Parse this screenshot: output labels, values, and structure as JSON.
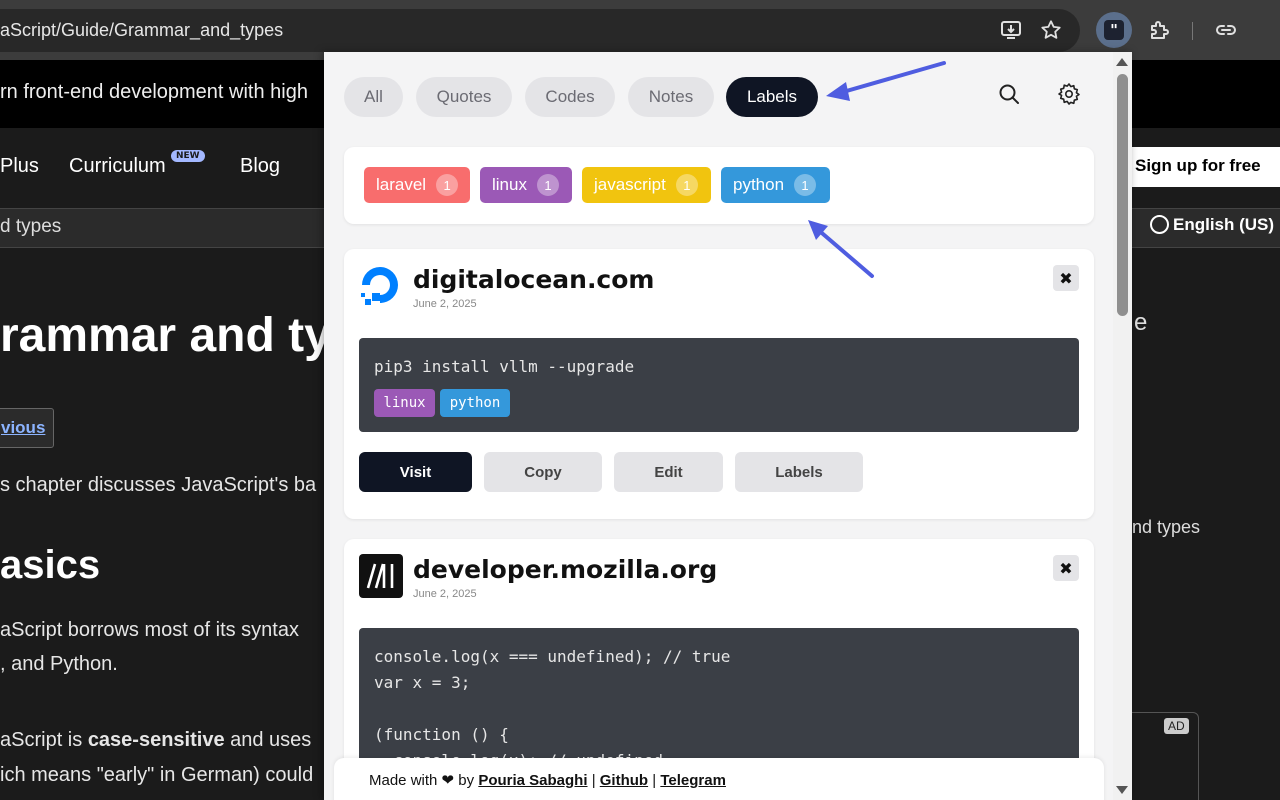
{
  "browser": {
    "url": "aScript/Guide/Grammar_and_types"
  },
  "background_page": {
    "banner": "rn front-end development with high",
    "nav": [
      {
        "label": "Plus"
      },
      {
        "label": "Curriculum"
      },
      {
        "label": "Blog"
      }
    ],
    "new_badge": "NEW",
    "signup": "Sign up for free",
    "breadcrumb": "d types",
    "language": "English (US)",
    "title": "rammar and ty",
    "previous": "vious",
    "intro": "s chapter discusses JavaScript's ba",
    "heading2": "asics",
    "para1_line1": "aScript borrows most of its syntax",
    "para1_line2": ", and Python.",
    "para2_prefix": "aScript is ",
    "para2_bold": "case-sensitive",
    "para2_suffix": " and uses",
    "para2_line2": "ich means \"early\" in German) could",
    "right_e": "e",
    "right_types": "nd types",
    "ad": "AD"
  },
  "popup": {
    "tabs": [
      {
        "label": "All",
        "active": false
      },
      {
        "label": "Quotes",
        "active": false
      },
      {
        "label": "Codes",
        "active": false
      },
      {
        "label": "Notes",
        "active": false
      },
      {
        "label": "Labels",
        "active": true
      }
    ],
    "labels": [
      {
        "name": "laravel",
        "count": "1",
        "color": "#f86d6d"
      },
      {
        "name": "linux",
        "count": "1",
        "color": "#9b59b6"
      },
      {
        "name": "javascript",
        "count": "1",
        "color": "#f1c40f"
      },
      {
        "name": "python",
        "count": "1",
        "color": "#3498db"
      }
    ],
    "items": [
      {
        "site": "digitalocean.com",
        "date": "June 2, 2025",
        "code": [
          "pip3 install vllm --upgrade"
        ],
        "tags": [
          {
            "name": "linux",
            "color": "#9b59b6"
          },
          {
            "name": "python",
            "color": "#3498db"
          }
        ],
        "actions": [
          "Visit",
          "Copy",
          "Edit",
          "Labels"
        ]
      },
      {
        "site": "developer.mozilla.org",
        "date": "June 2, 2025",
        "code": [
          "console.log(x === undefined); // true",
          "var x = 3;",
          "",
          "(function () {",
          "  console.log(x); // undefined"
        ]
      }
    ],
    "close_symbol": "✖",
    "footer": {
      "made_with": "Made with",
      "by": "by",
      "author": "Pouria Sabaghi",
      "sep": "|",
      "github": "Github",
      "telegram": "Telegram"
    }
  },
  "colors": {
    "accent_dark": "#0f1524",
    "arrow": "#4f5de0",
    "code_bg": "#3b3f46"
  }
}
